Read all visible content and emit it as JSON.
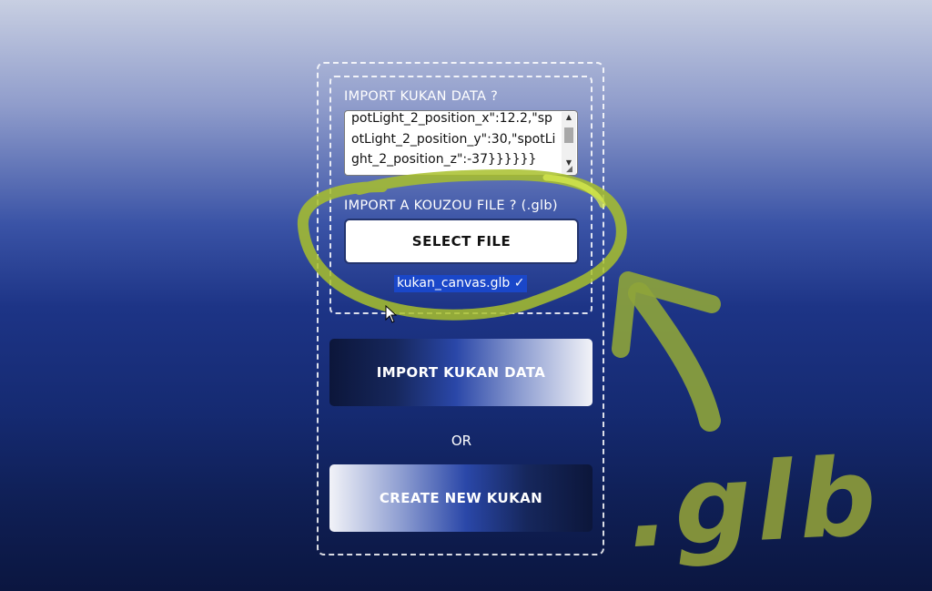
{
  "form": {
    "import_label": "IMPORT KUKAN DATA ?",
    "textarea_value": "potLight_2_position_x\":12.2,\"spotLight_2_position_y\":30,\"spotLight_2_position_z\":-37}}}}}}",
    "kouzou_label": "IMPORT A KOUZOU FILE ? (.glb)",
    "select_file_label": "SELECT FILE",
    "selected_filename": "kukan_canvas.glb ✓"
  },
  "actions": {
    "import_button_label": "IMPORT KUKAN DATA",
    "or_label": "OR",
    "create_button_label": "CREATE NEW KUKAN"
  },
  "annotation": {
    "text": ".glb",
    "color": "#8b9a3a",
    "highlight_color": "#d6e84a"
  },
  "icons": {
    "scroll_up": "triangle-up-icon",
    "scroll_down": "triangle-down-icon",
    "resize": "resize-grip-icon",
    "cursor": "mouse-pointer-icon"
  }
}
